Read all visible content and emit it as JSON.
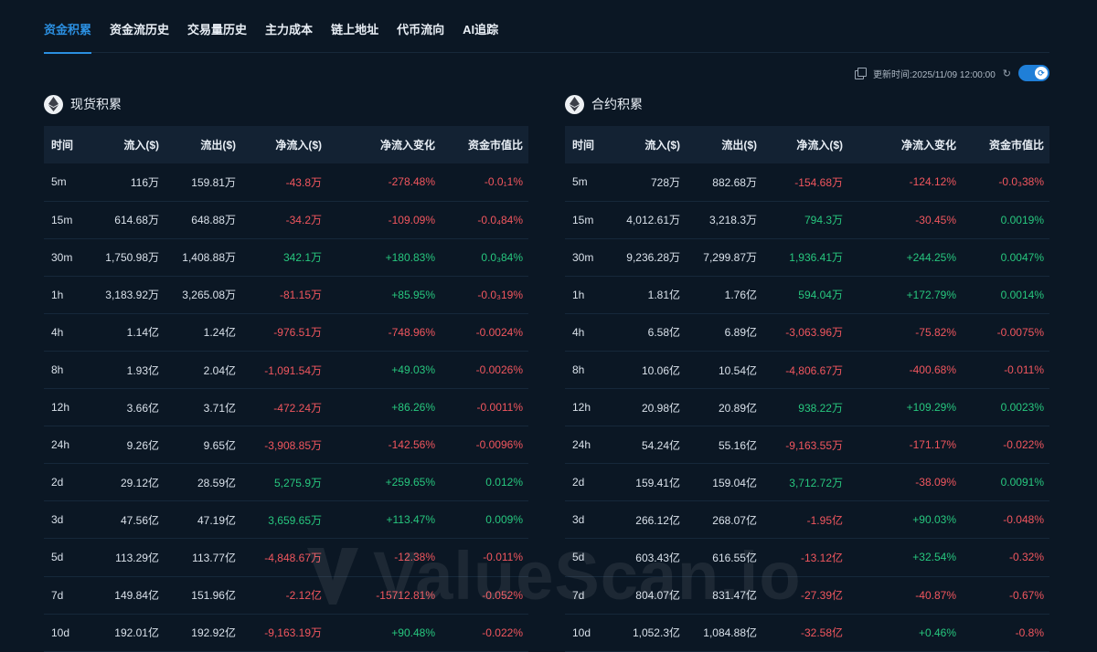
{
  "tabs": [
    "资金积累",
    "资金流历史",
    "交易量历史",
    "主力成本",
    "链上地址",
    "代币流向",
    "AI追踪"
  ],
  "update_time": "更新时间:2025/11/09 12:00:00",
  "watermark": "ValueScan.io",
  "colors": {
    "accent": "#2b8fe0",
    "positive": "#27c77e",
    "negative": "#f1565e",
    "background": "#0b1724"
  },
  "spot": {
    "title": "现货积累",
    "icon": "ethereum-icon",
    "columns": [
      "时间",
      "流入($)",
      "流出($)",
      "净流入($)",
      "净流入变化",
      "资金市值比"
    ],
    "rows": [
      [
        "5m",
        "116万",
        "159.81万",
        "-43.8万",
        "-278.48%",
        "-0.0₁1%"
      ],
      [
        "15m",
        "614.68万",
        "648.88万",
        "-34.2万",
        "-109.09%",
        "-0.0₄84%"
      ],
      [
        "30m",
        "1,750.98万",
        "1,408.88万",
        "342.1万",
        "+180.83%",
        "0.0₃84%"
      ],
      [
        "1h",
        "3,183.92万",
        "3,265.08万",
        "-81.15万",
        "+85.95%",
        "-0.0₃19%"
      ],
      [
        "4h",
        "1.14亿",
        "1.24亿",
        "-976.51万",
        "-748.96%",
        "-0.0024%"
      ],
      [
        "8h",
        "1.93亿",
        "2.04亿",
        "-1,091.54万",
        "+49.03%",
        "-0.0026%"
      ],
      [
        "12h",
        "3.66亿",
        "3.71亿",
        "-472.24万",
        "+86.26%",
        "-0.0011%"
      ],
      [
        "24h",
        "9.26亿",
        "9.65亿",
        "-3,908.85万",
        "-142.56%",
        "-0.0096%"
      ],
      [
        "2d",
        "29.12亿",
        "28.59亿",
        "5,275.9万",
        "+259.65%",
        "0.012%"
      ],
      [
        "3d",
        "47.56亿",
        "47.19亿",
        "3,659.65万",
        "+113.47%",
        "0.009%"
      ],
      [
        "5d",
        "113.29亿",
        "113.77亿",
        "-4,848.67万",
        "-12.38%",
        "-0.011%"
      ],
      [
        "7d",
        "149.84亿",
        "151.96亿",
        "-2.12亿",
        "-15712.81%",
        "-0.052%"
      ],
      [
        "10d",
        "192.01亿",
        "192.92亿",
        "-9,163.19万",
        "+90.48%",
        "-0.022%"
      ]
    ]
  },
  "futures": {
    "title": "合约积累",
    "icon": "ethereum-icon",
    "columns": [
      "时间",
      "流入($)",
      "流出($)",
      "净流入($)",
      "净流入变化",
      "资金市值比"
    ],
    "rows": [
      [
        "5m",
        "728万",
        "882.68万",
        "-154.68万",
        "-124.12%",
        "-0.0₃38%"
      ],
      [
        "15m",
        "4,012.61万",
        "3,218.3万",
        "794.3万",
        "-30.45%",
        "0.0019%"
      ],
      [
        "30m",
        "9,236.28万",
        "7,299.87万",
        "1,936.41万",
        "+244.25%",
        "0.0047%"
      ],
      [
        "1h",
        "1.81亿",
        "1.76亿",
        "594.04万",
        "+172.79%",
        "0.0014%"
      ],
      [
        "4h",
        "6.58亿",
        "6.89亿",
        "-3,063.96万",
        "-75.82%",
        "-0.0075%"
      ],
      [
        "8h",
        "10.06亿",
        "10.54亿",
        "-4,806.67万",
        "-400.68%",
        "-0.011%"
      ],
      [
        "12h",
        "20.98亿",
        "20.89亿",
        "938.22万",
        "+109.29%",
        "0.0023%"
      ],
      [
        "24h",
        "54.24亿",
        "55.16亿",
        "-9,163.55万",
        "-171.17%",
        "-0.022%"
      ],
      [
        "2d",
        "159.41亿",
        "159.04亿",
        "3,712.72万",
        "-38.09%",
        "0.0091%"
      ],
      [
        "3d",
        "266.12亿",
        "268.07亿",
        "-1.95亿",
        "+90.03%",
        "-0.048%"
      ],
      [
        "5d",
        "603.43亿",
        "616.55亿",
        "-13.12亿",
        "+32.54%",
        "-0.32%"
      ],
      [
        "7d",
        "804.07亿",
        "831.47亿",
        "-27.39亿",
        "-40.87%",
        "-0.67%"
      ],
      [
        "10d",
        "1,052.3亿",
        "1,084.88亿",
        "-32.58亿",
        "+0.46%",
        "-0.8%"
      ]
    ]
  }
}
